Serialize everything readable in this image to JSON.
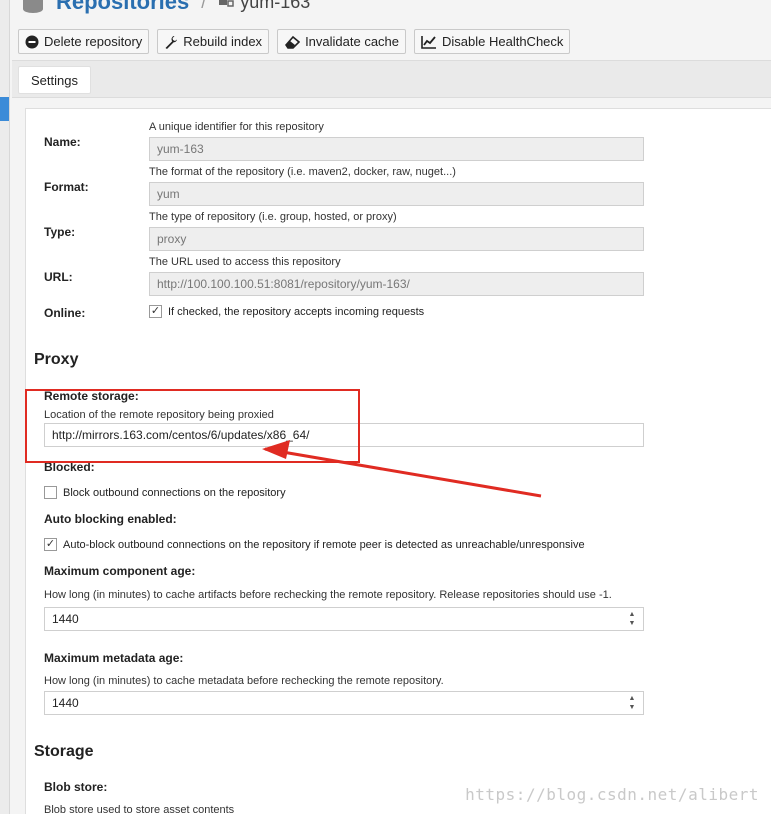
{
  "header": {
    "title": "Repositories",
    "separator": "/",
    "repo_name": "yum-163"
  },
  "toolbar": {
    "delete_label": "Delete repository",
    "rebuild_label": "Rebuild index",
    "invalidate_label": "Invalidate cache",
    "healthcheck_label": "Disable HealthCheck"
  },
  "tabs": {
    "settings": "Settings"
  },
  "settings": {
    "name": {
      "label": "Name:",
      "help": "A unique identifier for this repository",
      "value": "yum-163"
    },
    "format": {
      "label": "Format:",
      "help": "The format of the repository (i.e. maven2, docker, raw, nuget...)",
      "value": "yum"
    },
    "type": {
      "label": "Type:",
      "help": "The type of repository (i.e. group, hosted, or proxy)",
      "value": "proxy"
    },
    "url": {
      "label": "URL:",
      "help": "The URL used to access this repository",
      "value": "http://100.100.100.51:8081/repository/yum-163/"
    },
    "online": {
      "label": "Online:",
      "help": "If checked, the repository accepts incoming requests",
      "checked": true
    }
  },
  "proxy": {
    "title": "Proxy",
    "remote_storage": {
      "label": "Remote storage:",
      "help": "Location of the remote repository being proxied",
      "value": "http://mirrors.163.com/centos/6/updates/x86_64/"
    },
    "blocked": {
      "label": "Blocked:",
      "help": "Block outbound connections on the repository",
      "checked": false
    },
    "auto_blocking": {
      "label": "Auto blocking enabled:",
      "help": "Auto-block outbound connections on the repository if remote peer is detected as unreachable/unresponsive",
      "checked": true
    },
    "max_component_age": {
      "label": "Maximum component age:",
      "help": "How long (in minutes) to cache artifacts before rechecking the remote repository. Release repositories should use -1.",
      "value": "1440"
    },
    "max_metadata_age": {
      "label": "Maximum metadata age:",
      "help": "How long (in minutes) to cache metadata before rechecking the remote repository.",
      "value": "1440"
    }
  },
  "storage": {
    "title": "Storage",
    "blob_store": {
      "label": "Blob store:",
      "help": "Blob store used to store asset contents"
    }
  },
  "watermark": "https://blog.csdn.net/alibert",
  "colors": {
    "title_blue": "#2a6fb0",
    "annotation_red": "#e02b22",
    "nav_active": "#3b8bd8"
  }
}
